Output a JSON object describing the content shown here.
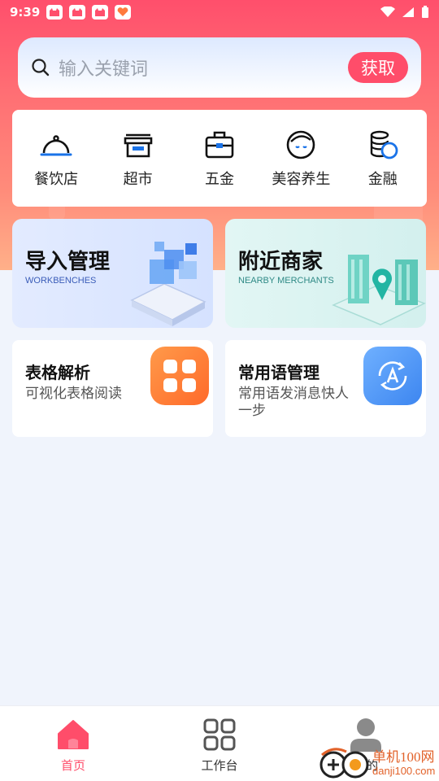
{
  "status_bar": {
    "time": "9:39",
    "app_icons": [
      "cat-app-icon",
      "cat-app-icon",
      "cat-app-icon",
      "heart-app-icon"
    ],
    "system_icons": [
      "wifi-icon",
      "signal-icon",
      "battery-icon"
    ]
  },
  "search": {
    "placeholder": "输入关键词",
    "button_label": "获取"
  },
  "categories": [
    {
      "label": "餐饮店",
      "icon": "dish-cover-icon"
    },
    {
      "label": "超市",
      "icon": "store-icon"
    },
    {
      "label": "五金",
      "icon": "toolbox-icon"
    },
    {
      "label": "美容养生",
      "icon": "beauty-face-icon"
    },
    {
      "label": "金融",
      "icon": "coins-icon"
    }
  ],
  "features": [
    {
      "title": "导入管理",
      "subtitle": "WORKBENCHES",
      "subtitle_color": "#3a5cb8"
    },
    {
      "title": "附近商家",
      "subtitle": "NEARBY MERCHANTS",
      "subtitle_color": "#2f8a86"
    }
  ],
  "tools": [
    {
      "title": "表格解析",
      "description": "可视化表格阅读",
      "icon": "grid-apps-icon"
    },
    {
      "title": "常用语管理",
      "description": "常用语发消息快人一步",
      "icon": "translate-icon"
    }
  ],
  "bottom_nav": [
    {
      "label": "首页",
      "icon": "home-icon",
      "active": true
    },
    {
      "label": "工作台",
      "icon": "workbench-icon",
      "active": false
    },
    {
      "label": "我的",
      "icon": "profile-icon",
      "active": false
    }
  ],
  "colors": {
    "accent": "#ff4d6a",
    "nav_active": "#ff4d6a",
    "nav_inactive": "#333333",
    "icon_blue": "#1a73e8"
  },
  "watermark": {
    "line1": "单机100网",
    "line2": "danji100.com"
  }
}
